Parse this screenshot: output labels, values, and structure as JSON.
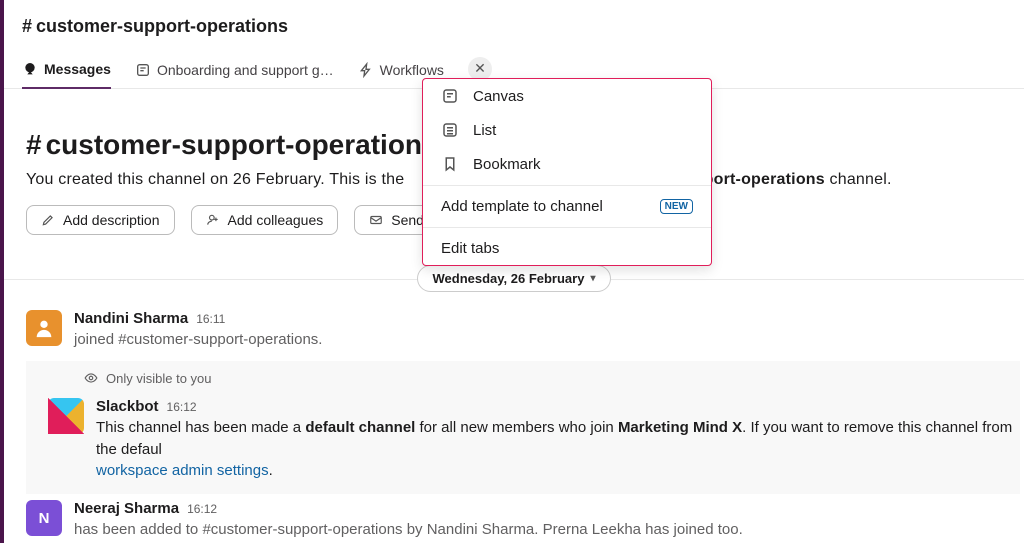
{
  "channel": {
    "name": "customer-support-operations"
  },
  "tabs": {
    "messages": "Messages",
    "onboarding": "Onboarding and support g…",
    "workflows": "Workflows"
  },
  "dropdown": {
    "canvas": "Canvas",
    "list": "List",
    "bookmark": "Bookmark",
    "addTemplate": "Add template to channel",
    "newBadge": "NEW",
    "editTabs": "Edit tabs"
  },
  "welcome": {
    "prefix": "You created this channel on 26 February. This is the ",
    "channelBold": "port-operations",
    "suffix": " channel.",
    "addDescription": "Add description",
    "addColleagues": "Add colleagues",
    "sendEmails": "Send en"
  },
  "dateDivider": "Wednesday, 26 February",
  "messages": {
    "m1": {
      "name": "Nandini Sharma",
      "time": "16:11",
      "text": "joined #customer-support-operations."
    },
    "notice": "Only visible to you",
    "m2": {
      "name": "Slackbot",
      "time": "16:12",
      "text_a": "This channel has been made a ",
      "bold_a": "default channel",
      "text_b": " for all new members who join ",
      "bold_b": "Marketing Mind X",
      "text_c": ". If you want to remove this channel from the defaul",
      "link": "workspace admin settings",
      "text_d": "."
    },
    "m3": {
      "name": "Neeraj Sharma",
      "avatarLetter": "N",
      "time": "16:12",
      "text": "has been added to #customer-support-operations by Nandini Sharma. Prerna Leekha has joined too."
    }
  }
}
